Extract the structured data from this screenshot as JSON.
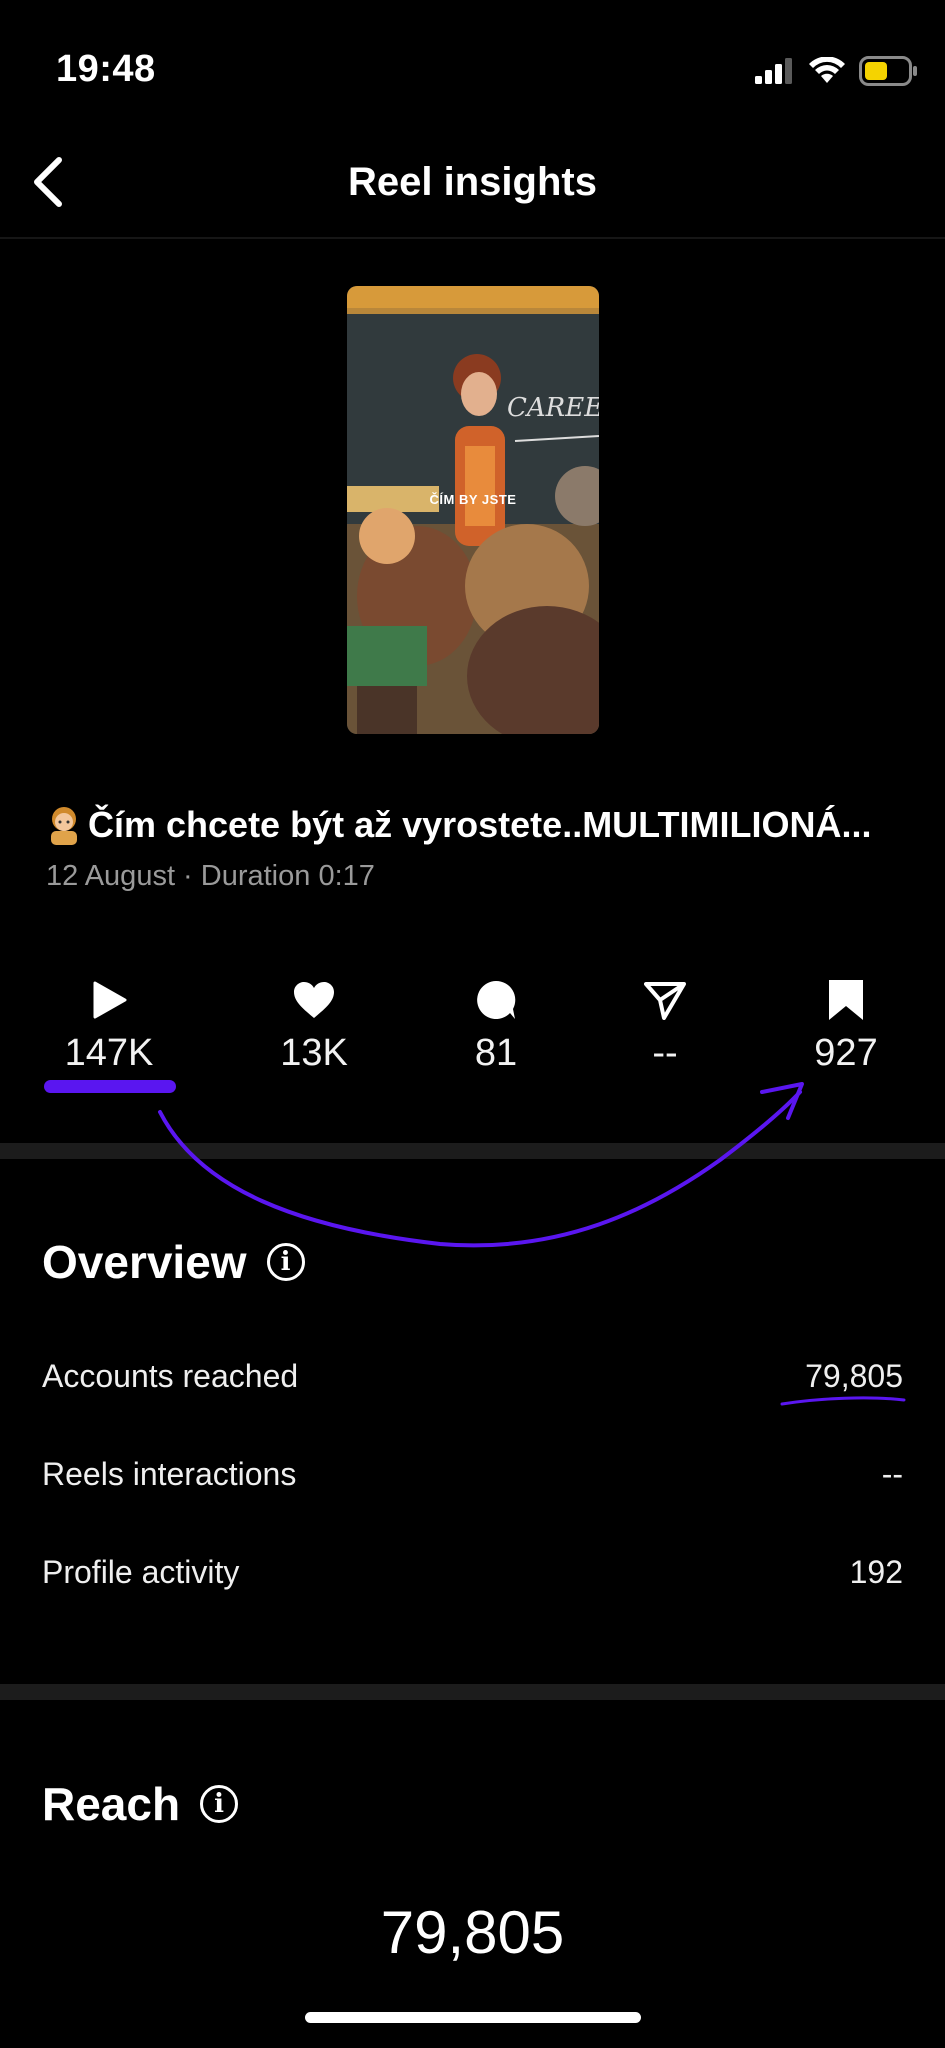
{
  "status_bar": {
    "time": "19:48",
    "signal_icon": "cellular-signal-icon",
    "wifi_icon": "wifi-icon",
    "battery_icon": "battery-icon",
    "battery_color": "#f5d300"
  },
  "header": {
    "title": "Reel insights",
    "back_icon": "chevron-left-icon"
  },
  "reel": {
    "thumbnail_caption": "ČÍM BY JSTE",
    "title": "Čím chcete být až vyrostete..MULTIMILIONÁ...",
    "title_emoji": "teacher-emoji",
    "meta": "12 August · Duration 0:17"
  },
  "stats": [
    {
      "icon": "play-icon",
      "value": "147K"
    },
    {
      "icon": "heart-icon",
      "value": "13K"
    },
    {
      "icon": "comment-icon",
      "value": "81"
    },
    {
      "icon": "send-icon",
      "value": "--"
    },
    {
      "icon": "bookmark-icon",
      "value": "927"
    }
  ],
  "overview": {
    "title": "Overview",
    "rows": [
      {
        "label": "Accounts reached",
        "value": "79,805"
      },
      {
        "label": "Reels interactions",
        "value": "--"
      },
      {
        "label": "Profile activity",
        "value": "192"
      }
    ]
  },
  "reach": {
    "title": "Reach",
    "total": "79,805"
  },
  "annotation_color": "#5a16f0"
}
